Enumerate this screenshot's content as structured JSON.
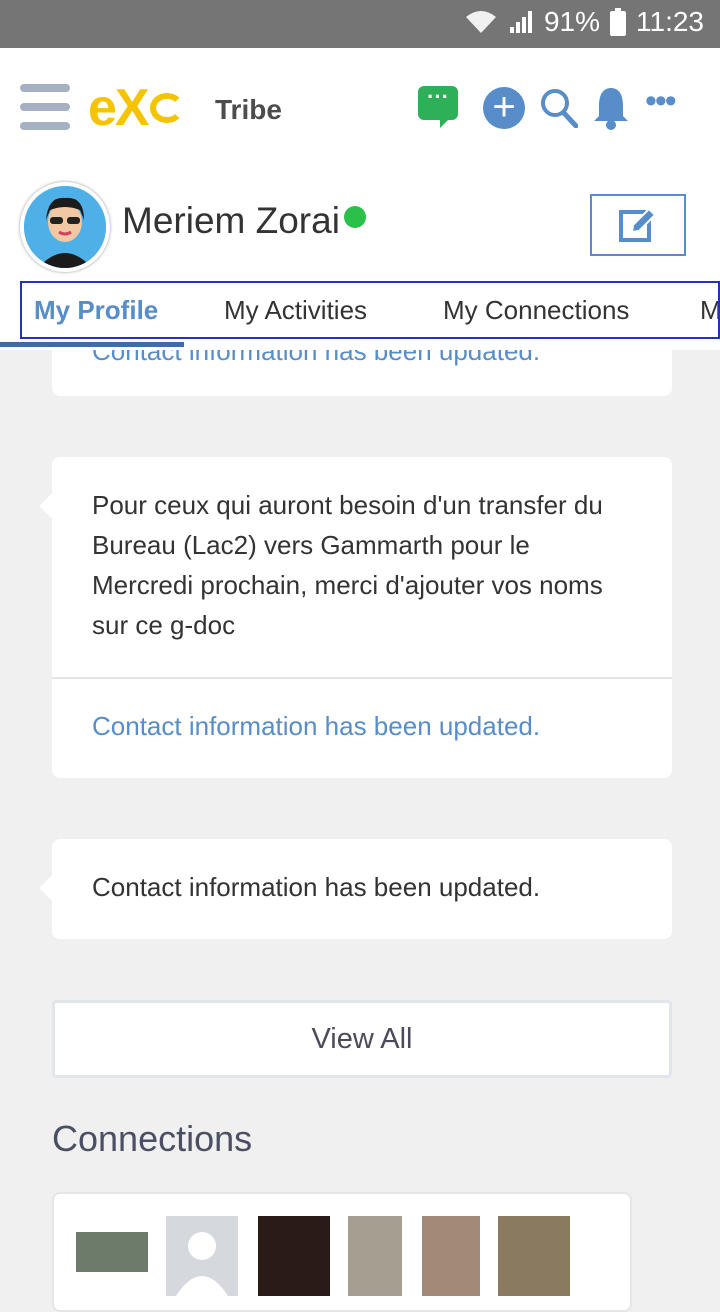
{
  "status_bar": {
    "battery": "91%",
    "time": "11:23"
  },
  "app_bar": {
    "logo": "eX",
    "brand_label": "Tribe",
    "chat_glyph": "···",
    "plus_glyph": "+",
    "more_glyph": "•••"
  },
  "profile": {
    "name": "Meriem Zorai",
    "status": "online"
  },
  "tabs": [
    {
      "label": "My Profile",
      "active": true
    },
    {
      "label": "My Activities",
      "active": false
    },
    {
      "label": "My Connections",
      "active": false
    },
    {
      "label": "M",
      "active": false
    }
  ],
  "activities": [
    {
      "link": "Contact information has been updated."
    },
    {
      "text": "Pour ceux qui auront besoin d'un transfer du Bureau (Lac2) vers Gammarth pour le Mercredi prochain, merci d'ajouter vos noms sur ce g-doc",
      "link": "Contact information has been updated."
    },
    {
      "text": "Contact information has been updated."
    }
  ],
  "view_all_label": "View All",
  "connections": {
    "title": "Connections"
  },
  "colors": {
    "accent": "#578dc9",
    "online": "#2bc04a",
    "logo": "#f5c400",
    "chat": "#2eb058"
  },
  "icons": [
    "menu-icon",
    "chat-icon",
    "plus-icon",
    "search-icon",
    "bell-icon",
    "more-icon",
    "edit-icon",
    "wifi-icon",
    "signal-icon",
    "battery-icon"
  ]
}
